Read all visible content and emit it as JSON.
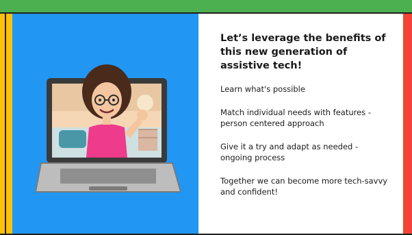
{
  "heading": "Let’s leverage the benefits of this new generation of assistive tech!",
  "points": [
    "Learn what's possible",
    "Match individual needs with features - person centered approach",
    "Give it a try and adapt as needed - ongoing process",
    "Together we can become more tech-savvy and confident!"
  ],
  "colors": {
    "top": "#4caf50",
    "left": "#ffc107",
    "panel": "#2196f3",
    "right": "#f44336"
  },
  "illustration": "bitmoji-woman-waving-from-laptop"
}
